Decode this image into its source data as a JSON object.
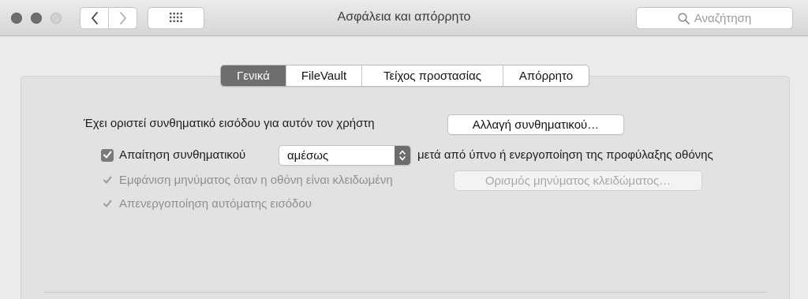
{
  "window": {
    "title": "Ασφάλεια και απόρρητο"
  },
  "toolbar": {
    "back_icon": "chevron-left-icon",
    "forward_icon": "chevron-right-icon",
    "show_all_icon": "grid-icon",
    "search": {
      "placeholder": "Αναζήτηση",
      "icon": "search-icon"
    }
  },
  "tabs": [
    {
      "label": "Γενικά",
      "selected": true
    },
    {
      "label": "FileVault",
      "selected": false
    },
    {
      "label": "Τείχος προστασίας",
      "selected": false
    },
    {
      "label": "Απόρρητο",
      "selected": false
    }
  ],
  "general": {
    "password_set_text": "Έχει οριστεί συνθηματικό εισόδου για αυτόν τον χρήστη",
    "change_password_button": "Αλλαγή συνθηματικού…",
    "require_password": {
      "label": "Απαίτηση συνθηματικού",
      "checked": true,
      "popup_value": "αμέσως",
      "suffix": "μετά από ύπνο ή ενεργοποίηση της προφύλαξης οθόνης"
    },
    "show_message": {
      "label": "Εμφάνιση μηνύματος όταν η οθόνη είναι κλειδωμένη",
      "checked": true,
      "enabled": false,
      "button": "Ορισμός μηνύματος κλειδώματος…"
    },
    "disable_auto_login": {
      "label": "Απενεργοποίηση αυτόματης εισόδου",
      "checked": true,
      "enabled": false
    }
  },
  "colors": {
    "selected_tab": "#6e6e6e",
    "checkbox_fill": "#7a7a7a",
    "disabled_text": "#8f8f8f"
  }
}
